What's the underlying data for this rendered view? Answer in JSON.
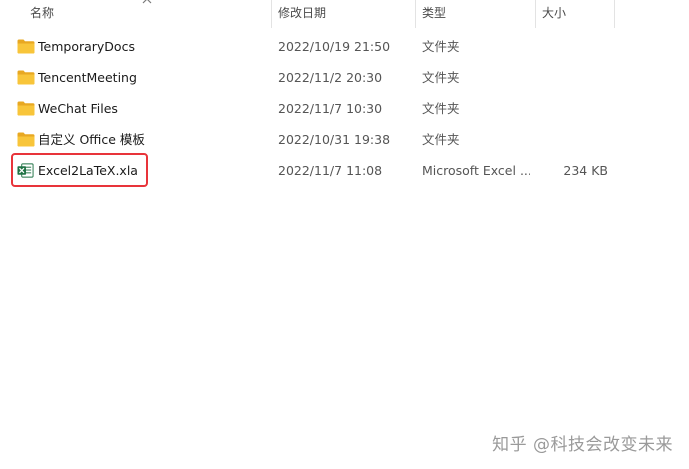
{
  "columns": {
    "name": "名称",
    "date": "修改日期",
    "type": "类型",
    "size": "大小"
  },
  "files": [
    {
      "name": "TemporaryDocs",
      "date": "2022/10/19 21:50",
      "type": "文件夹",
      "size": "",
      "icon": "folder-icon"
    },
    {
      "name": "TencentMeeting",
      "date": "2022/11/2 20:30",
      "type": "文件夹",
      "size": "",
      "icon": "folder-icon"
    },
    {
      "name": "WeChat Files",
      "date": "2022/11/7 10:30",
      "type": "文件夹",
      "size": "",
      "icon": "folder-icon"
    },
    {
      "name": "自定义 Office 模板",
      "date": "2022/10/31 19:38",
      "type": "文件夹",
      "size": "",
      "icon": "folder-icon"
    },
    {
      "name": "Excel2LaTeX.xla",
      "date": "2022/11/7 11:08",
      "type": "Microsoft Excel ...",
      "size": "234 KB",
      "icon": "excel-file-icon"
    }
  ],
  "watermark": "知乎 @科技会改变未来",
  "colors": {
    "folder": "#f8c53a",
    "folder_dark": "#e8a822",
    "excel": "#1f7244",
    "highlight": "#e8343a"
  }
}
